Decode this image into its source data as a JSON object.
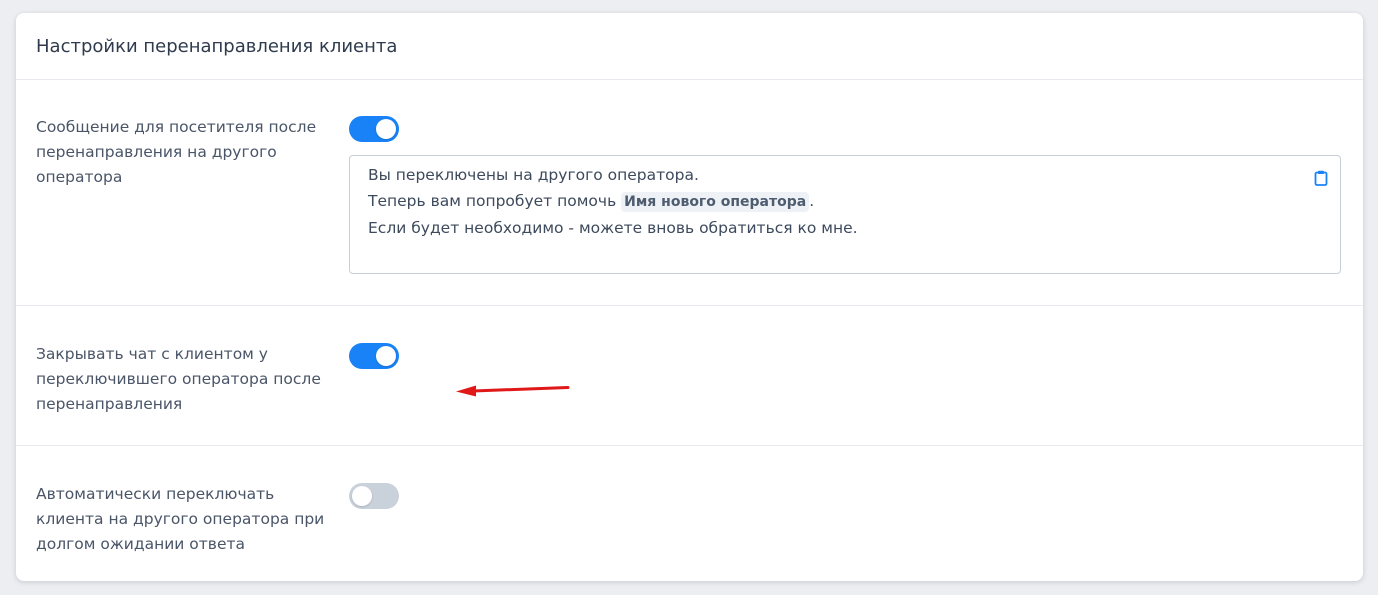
{
  "header": {
    "title": "Настройки перенаправления клиента"
  },
  "settings": [
    {
      "label_lines": [
        "Сообщение для посетителя после",
        "перенаправления на другого",
        "оператора"
      ],
      "enabled": true,
      "message": {
        "line1": "Вы переключены на другого оператора.",
        "line2_prefix": "Теперь вам попробует помочь ",
        "variable": "Имя нового оператора",
        "line2_suffix": ".",
        "line3": "Если будет необходимо - можете вновь обратиться ко мне."
      }
    },
    {
      "label_lines": [
        "Закрывать чат с клиентом у",
        "переключившего оператора после",
        "перенаправления"
      ],
      "enabled": true
    },
    {
      "label_lines": [
        "Автоматически переключать",
        "клиента на другого оператора при",
        "долгом ожидании ответа"
      ],
      "enabled": false
    }
  ],
  "colors": {
    "toggle_on": "#1a82f7",
    "toggle_off": "#c9d1db",
    "annotation_arrow": "#e01818",
    "icon_accent": "#1a82f7"
  },
  "icons": {
    "clipboard": "clipboard-icon"
  }
}
